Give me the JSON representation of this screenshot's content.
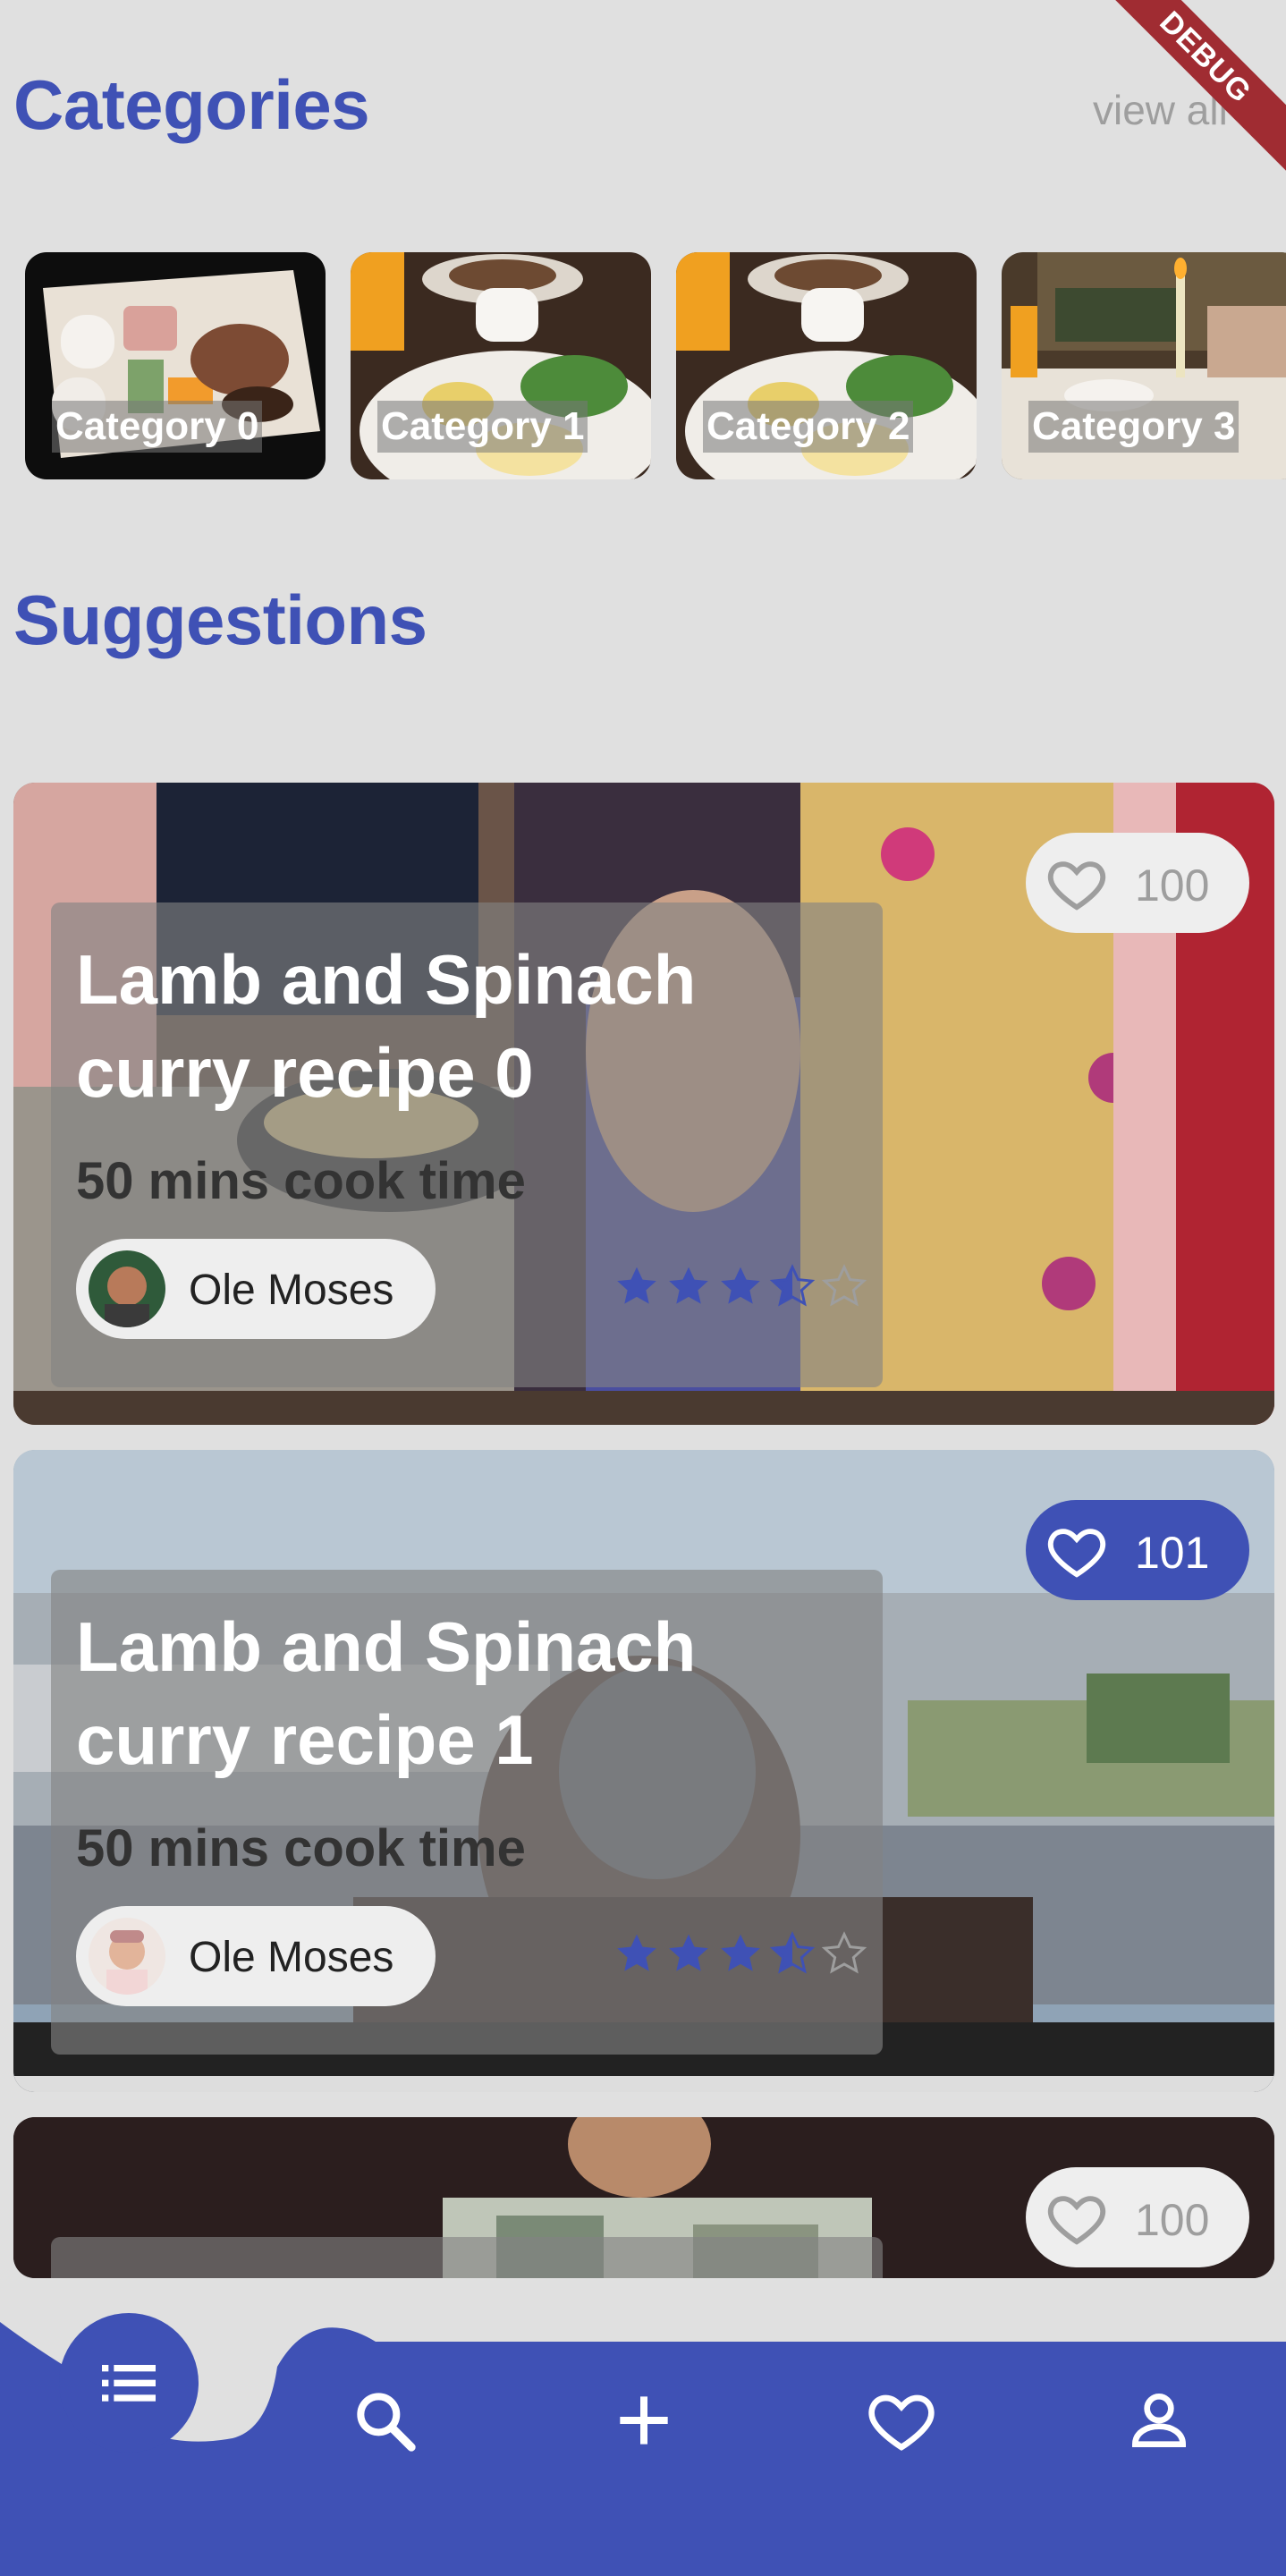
{
  "debug_banner": "DEBUG",
  "categories": {
    "title": "Categories",
    "view_all": "view all",
    "items": [
      {
        "label": "Category 0"
      },
      {
        "label": "Category 1"
      },
      {
        "label": "Category 2"
      },
      {
        "label": "Category 3"
      }
    ]
  },
  "suggestions": {
    "title": "Suggestions",
    "items": [
      {
        "title": "Lamb and Spinach curry recipe 0",
        "cook_time": "50 mins cook time",
        "author": "Ole Moses",
        "rating": 3.5,
        "likes": "100",
        "liked": false
      },
      {
        "title": "Lamb and Spinach curry recipe 1",
        "cook_time": "50 mins cook time",
        "author": "Ole Moses",
        "rating": 3.5,
        "likes": "101",
        "liked": true
      },
      {
        "title": "",
        "likes": "100",
        "liked": false
      }
    ]
  },
  "bottom_nav": {
    "items": [
      "list-icon",
      "search-icon",
      "add-icon",
      "heart-icon",
      "person-icon"
    ],
    "active": "list-icon"
  },
  "colors": {
    "accent": "#3f51b5",
    "background": "#e0e0e0",
    "muted_text": "#9e9e9e"
  }
}
